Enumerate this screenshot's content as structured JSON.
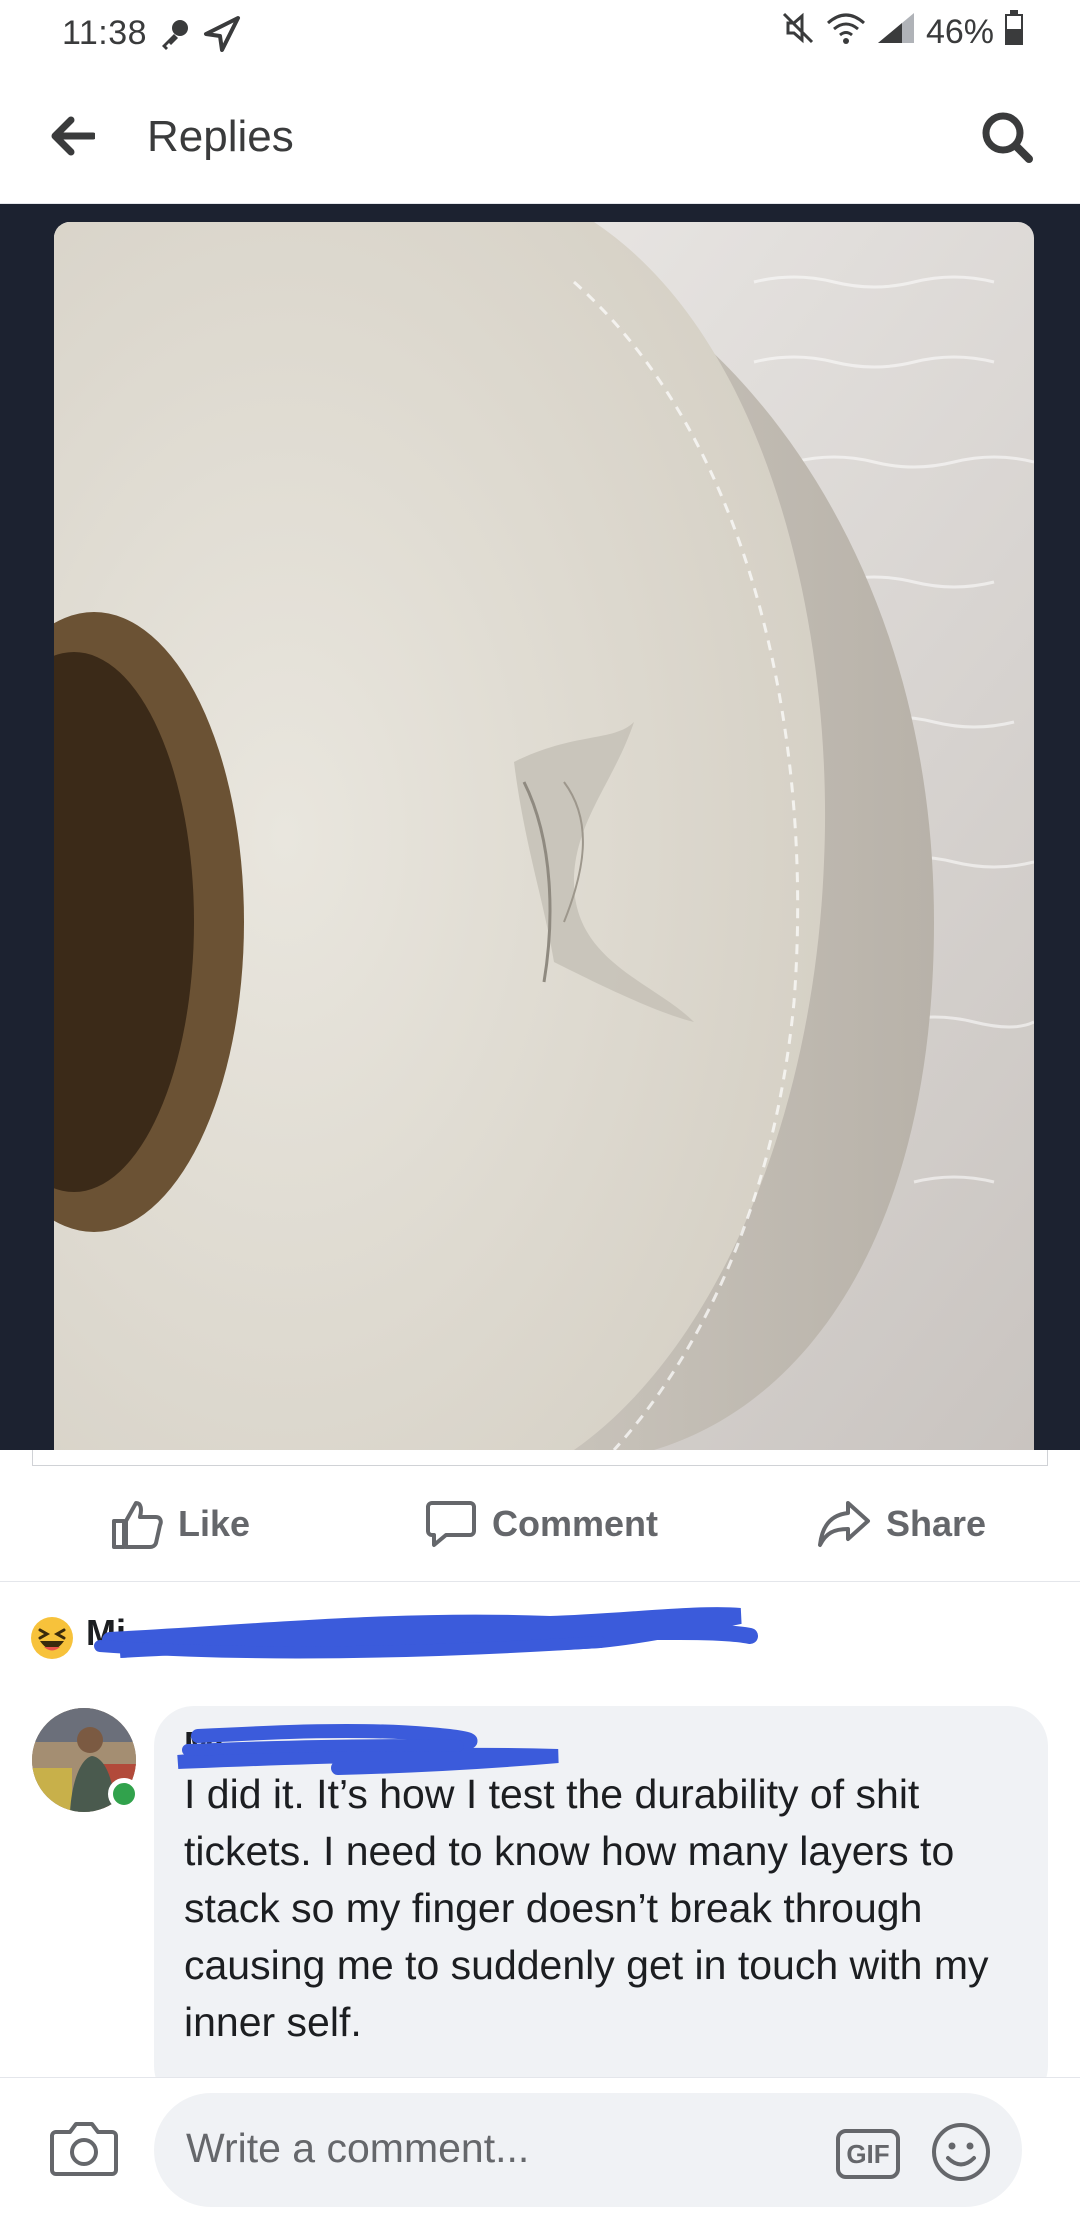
{
  "status_bar": {
    "time": "11:38",
    "battery": "46%"
  },
  "header": {
    "title": "Replies"
  },
  "actions": {
    "like": "Like",
    "comment": "Comment",
    "share": "Share"
  },
  "reactions": {
    "names": "Mi"
  },
  "comment": {
    "author": "Mi",
    "text": "I did it. It’s how I test the durability of shit tickets. I need to know how many layers to stack so my finger doesn’t break through causing me to suddenly get in touch with my inner self."
  },
  "composer": {
    "placeholder": "Write a comment...",
    "gif_label": "GIF"
  },
  "colors": {
    "redaction_scribble": "#3b5bdb",
    "photo_frame": "#1c2230",
    "online": "#31a24c"
  }
}
